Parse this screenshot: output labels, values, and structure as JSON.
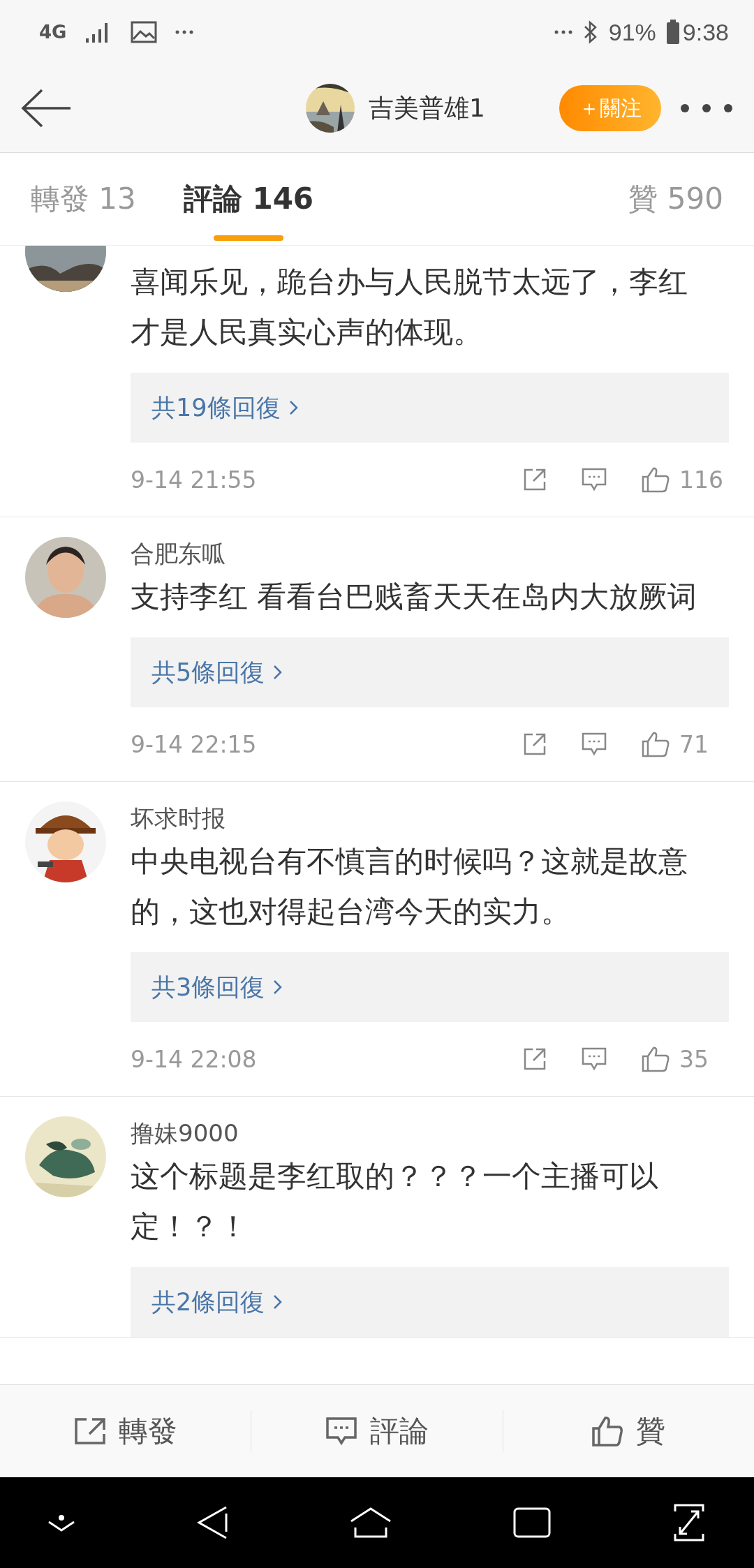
{
  "status_bar": {
    "network": "4G",
    "battery": "91%",
    "time": "9:38"
  },
  "header": {
    "title": "吉美普雄1",
    "follow_button": "＋關注"
  },
  "tabs": [
    {
      "label": "轉發",
      "count": "13",
      "selected": false
    },
    {
      "label": "評論",
      "count": "146",
      "selected": true
    },
    {
      "label": "贊",
      "count": "590",
      "selected": false
    }
  ],
  "comments": [
    {
      "text": "喜闻乐见，跪台办与人民脱节太远了，李红才是人民真实心声的体现。",
      "replies": "共19條回復",
      "time": "9-14 21:55",
      "likes": "116"
    },
    {
      "name": "合肥东呱",
      "text": "支持李红 看看台巴贱畜天天在岛内大放厥词",
      "replies": "共5條回復",
      "time": "9-14 22:15",
      "likes": "71"
    },
    {
      "name": "坏求时报",
      "text": "中央电视台有不慎言的时候吗？这就是故意的，这也对得起台湾今天的实力。",
      "replies": "共3條回復",
      "time": "9-14 22:08",
      "likes": "35"
    },
    {
      "name": "撸妹9000",
      "text": "这个标题是李红取的？？？一个主播可以定！？！",
      "replies": "共2條回復"
    }
  ],
  "bottom_bar": [
    {
      "kind": "share",
      "label": "轉發"
    },
    {
      "kind": "comment",
      "label": "評論"
    },
    {
      "kind": "like",
      "label": "贊"
    }
  ]
}
